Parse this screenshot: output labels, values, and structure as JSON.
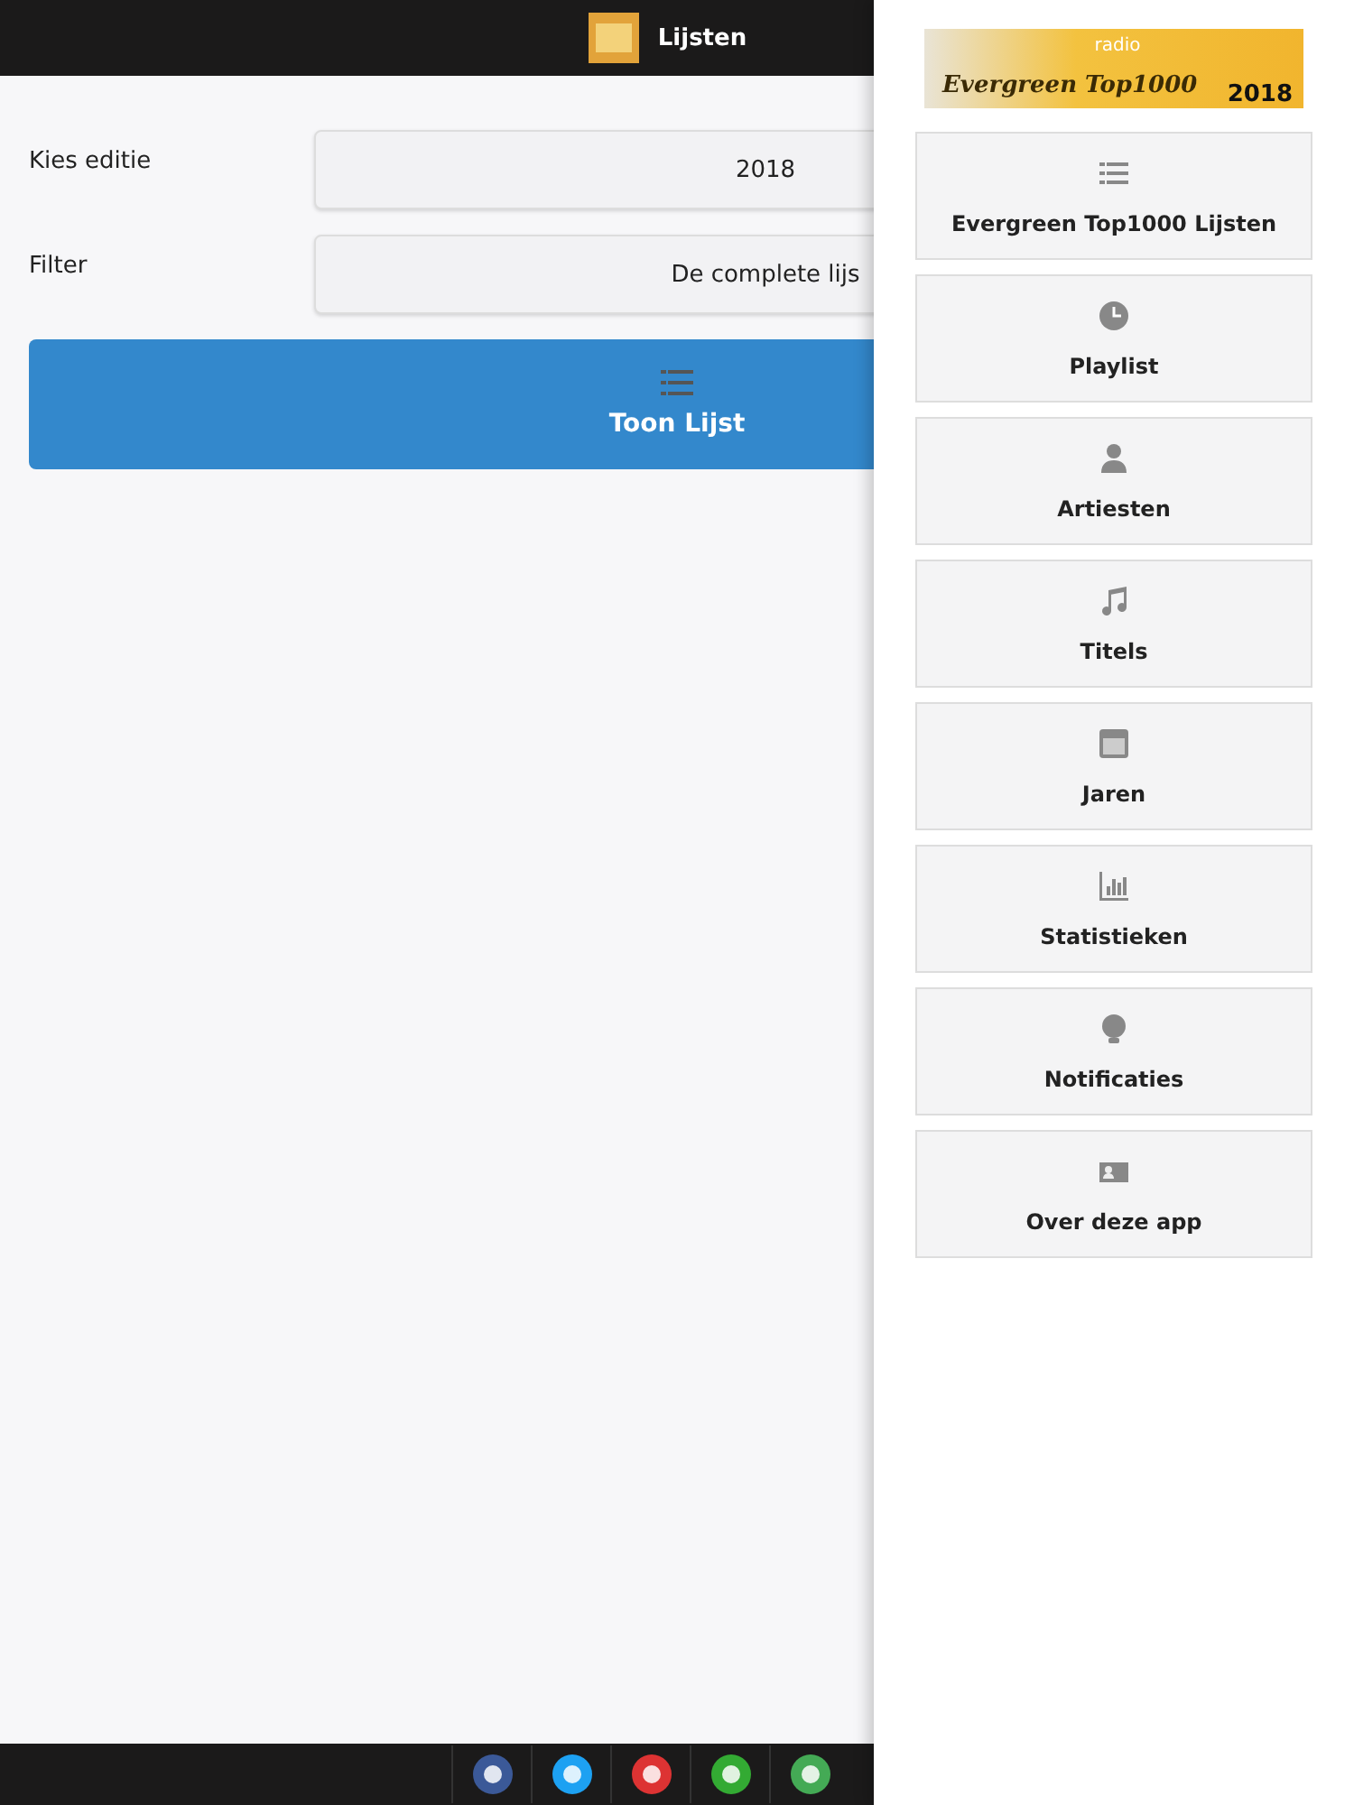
{
  "header": {
    "title": "Lijsten"
  },
  "form": {
    "fields": [
      {
        "label": "Kies editie",
        "value": "2018"
      },
      {
        "label": "Filter",
        "value": "De complete lijs"
      }
    ],
    "button": {
      "label": "Toon Lijst"
    }
  },
  "menu": {
    "logo": {
      "small": "radio",
      "title": "Evergreen Top1000",
      "year": "2018"
    },
    "items": [
      {
        "label": "Evergreen Top1000 Lijsten"
      },
      {
        "label": "Playlist"
      },
      {
        "label": "Artiesten"
      },
      {
        "label": "Titels"
      },
      {
        "label": "Jaren"
      },
      {
        "label": "Statistieken"
      },
      {
        "label": "Notificaties"
      },
      {
        "label": "Over deze app"
      }
    ]
  }
}
